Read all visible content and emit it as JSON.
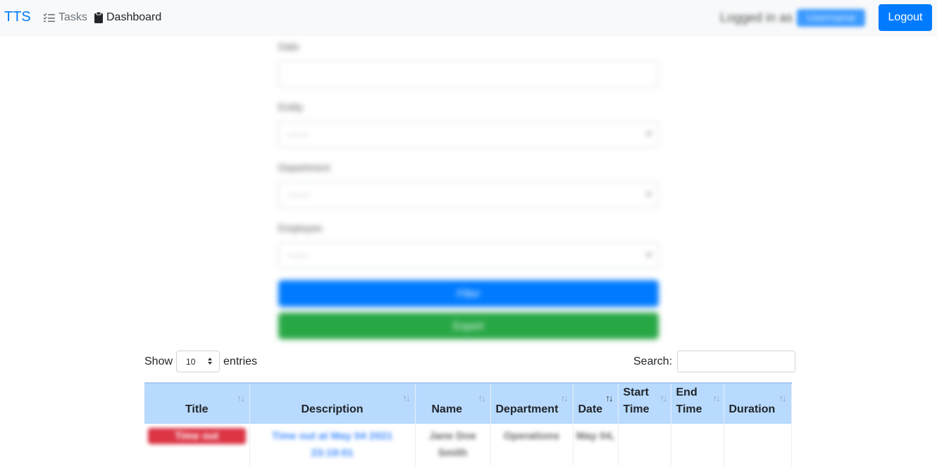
{
  "navbar": {
    "brand": "TTS",
    "tasks_label": "Tasks",
    "dashboard_label": "Dashboard",
    "logged_in_prefix": "Logged in as",
    "username": "Username",
    "logout_label": "Logout"
  },
  "filter_form": {
    "date_label": "Date",
    "entity_label": "Entity",
    "entity_value": "-------",
    "department_label": "Department",
    "department_value": "-------",
    "employee_label": "Employee",
    "employee_value": "-------",
    "filter_button": "Filter",
    "export_button": "Export"
  },
  "table_controls": {
    "show_label": "Show",
    "entries_value": "10",
    "entries_label": "entries",
    "search_label": "Search:"
  },
  "table": {
    "headers": [
      "Title",
      "Description",
      "Name",
      "Department",
      "Date",
      "Start Time",
      "End Time",
      "Duration"
    ],
    "active_sort_column": "Date",
    "rows": [
      {
        "title": "Time out",
        "description": "Time out at May 04 2021 23:19:01",
        "name": "Jane Doe Smith",
        "department": "Operations",
        "date": "May 04,",
        "start_time": "",
        "end_time": "",
        "duration": ""
      }
    ]
  },
  "colors": {
    "primary": "#007bff",
    "success": "#28a745",
    "danger": "#dc3545",
    "table_header": "#b8daff",
    "navbar_bg": "#f8f9fa"
  }
}
